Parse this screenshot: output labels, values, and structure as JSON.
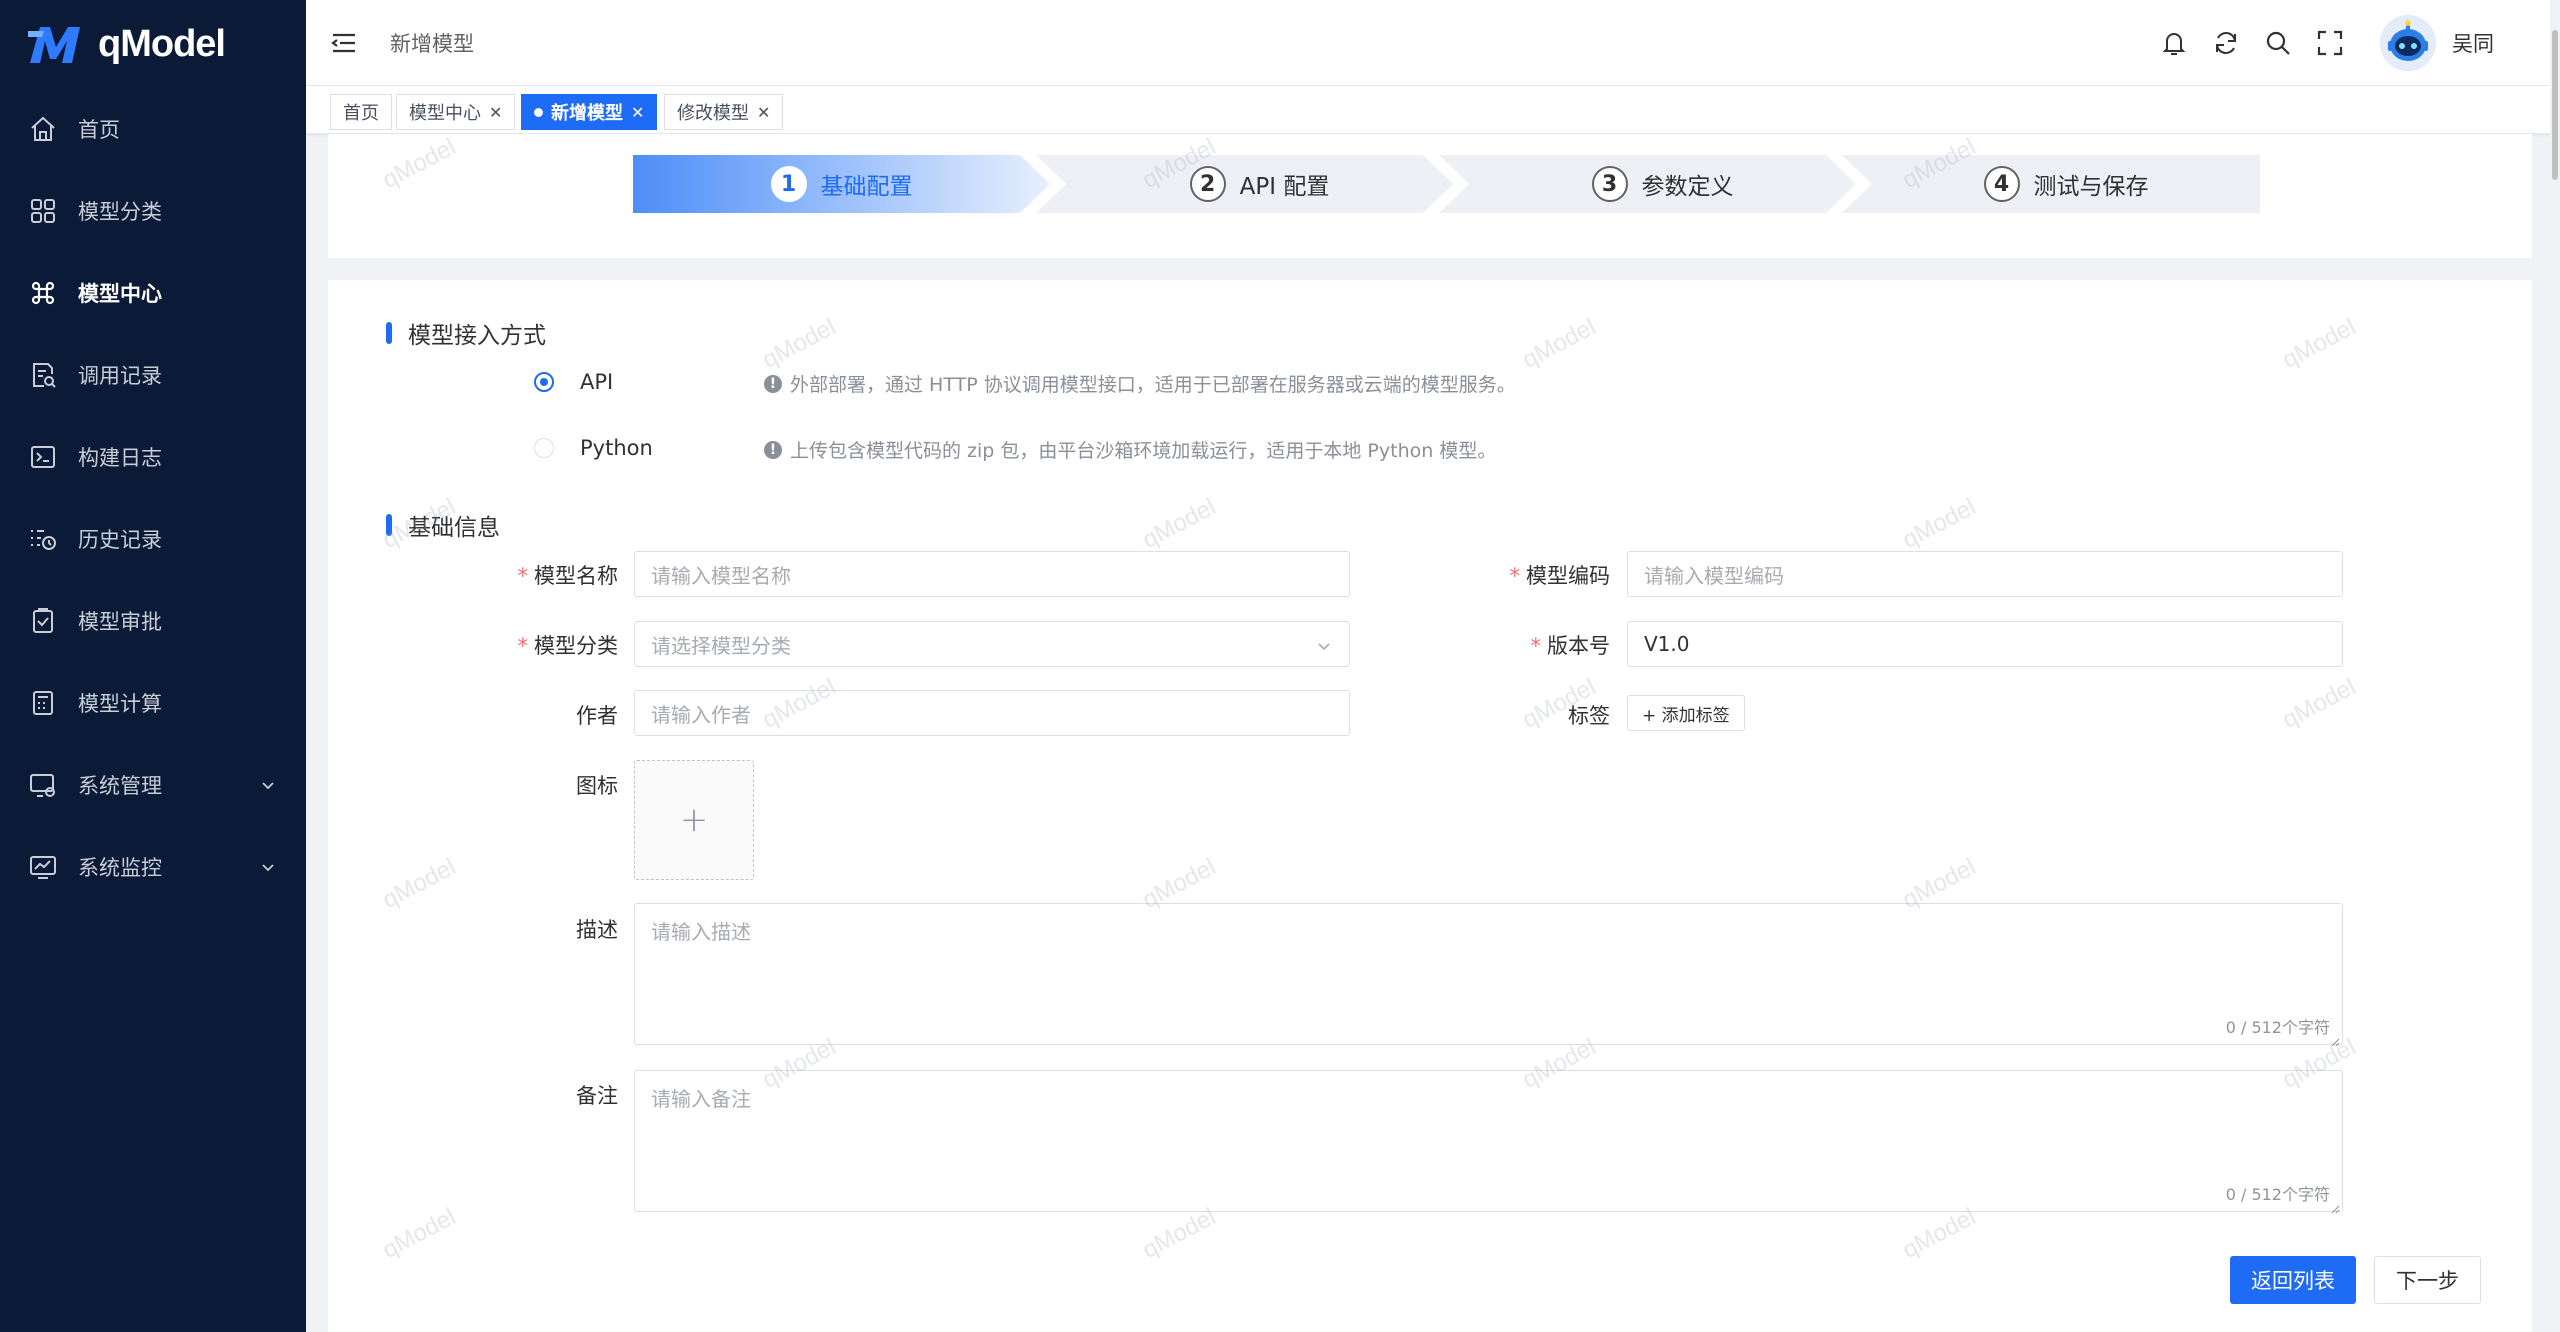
{
  "app": {
    "logo_text": "qModel",
    "watermark": "qModel"
  },
  "sidebar": {
    "items": [
      {
        "label": "首页",
        "icon": "home-icon"
      },
      {
        "label": "模型分类",
        "icon": "grid-icon"
      },
      {
        "label": "模型中心",
        "icon": "command-icon",
        "active": true
      },
      {
        "label": "调用记录",
        "icon": "document-search-icon"
      },
      {
        "label": "构建日志",
        "icon": "terminal-icon"
      },
      {
        "label": "历史记录",
        "icon": "history-list-icon"
      },
      {
        "label": "模型审批",
        "icon": "clipboard-check-icon"
      },
      {
        "label": "模型计算",
        "icon": "calculator-icon"
      },
      {
        "label": "系统管理",
        "icon": "monitor-settings-icon",
        "expandable": true
      },
      {
        "label": "系统监控",
        "icon": "monitor-chart-icon",
        "expandable": true
      }
    ]
  },
  "header": {
    "title": "新增模型",
    "username": "吴同"
  },
  "tabs": [
    {
      "label": "首页",
      "closable": false
    },
    {
      "label": "模型中心",
      "closable": true
    },
    {
      "label": "新增模型",
      "closable": true,
      "active": true
    },
    {
      "label": "修改模型",
      "closable": true
    }
  ],
  "steps": [
    {
      "num": "1",
      "label": "基础配置",
      "active": true
    },
    {
      "num": "2",
      "label": "API 配置"
    },
    {
      "num": "3",
      "label": "参数定义"
    },
    {
      "num": "4",
      "label": "测试与保存"
    }
  ],
  "access": {
    "title": "模型接入方式",
    "options": [
      {
        "label": "API",
        "checked": true,
        "hint": "外部部署，通过 HTTP 协议调用模型接口，适用于已部署在服务器或云端的模型服务。"
      },
      {
        "label": "Python",
        "checked": false,
        "hint": "上传包含模型代码的 zip 包，由平台沙箱环境加载运行，适用于本地 Python 模型。"
      }
    ]
  },
  "basic": {
    "title": "基础信息",
    "name": {
      "label": "模型名称",
      "placeholder": "请输入模型名称"
    },
    "code": {
      "label": "模型编码",
      "placeholder": "请输入模型编码"
    },
    "category": {
      "label": "模型分类",
      "placeholder": "请选择模型分类"
    },
    "version": {
      "label": "版本号",
      "value": "V1.0"
    },
    "author": {
      "label": "作者",
      "placeholder": "请输入作者"
    },
    "tags": {
      "label": "标签",
      "button": "+ 添加标签"
    },
    "icon": {
      "label": "图标",
      "plus": "+"
    },
    "description": {
      "label": "描述",
      "placeholder": "请输入描述",
      "count": "0 / 512个字符"
    },
    "remark": {
      "label": "备注",
      "placeholder": "请输入备注",
      "count": "0 / 512个字符"
    }
  },
  "actions": {
    "back": "返回列表",
    "next": "下一步"
  },
  "colors": {
    "primary": "#1e6bf5",
    "sidebar_bg": "#0b1a36",
    "required": "#f56c6c"
  }
}
